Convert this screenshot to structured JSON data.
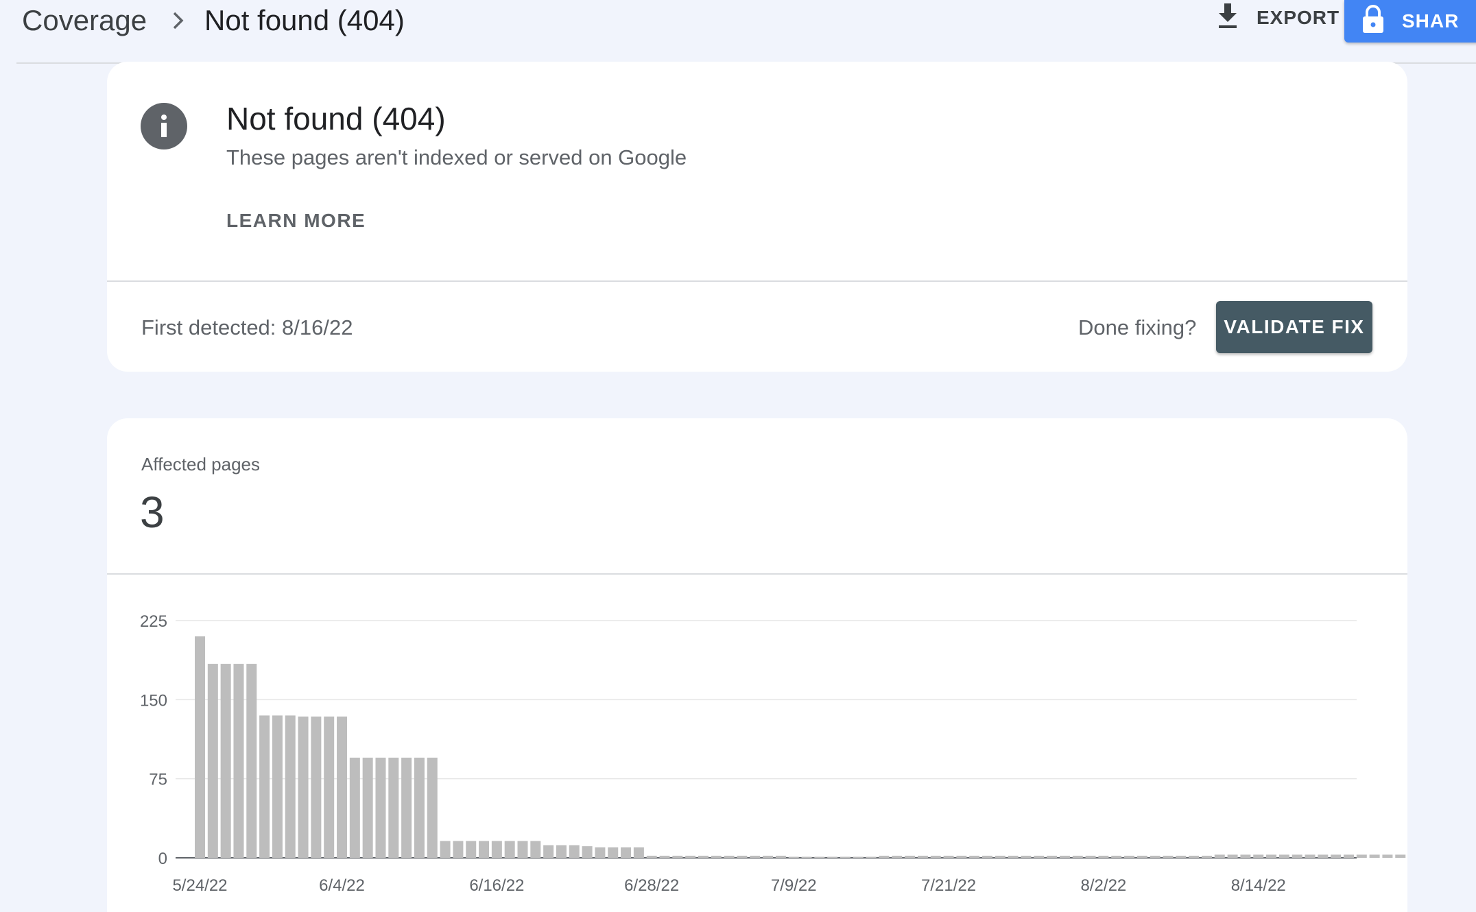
{
  "breadcrumb": {
    "root": "Coverage",
    "separator_icon": "chevron-right-icon",
    "current": "Not found (404)"
  },
  "toolbar": {
    "export_label": "EXPORT",
    "export_icon": "download-icon",
    "share_label": "SHAR",
    "share_icon": "lock-icon",
    "share_color": "#4285f4"
  },
  "issue": {
    "icon": "info-icon",
    "title": "Not found (404)",
    "subtitle": "These pages aren't indexed or served on Google",
    "learn_more": "LEARN MORE",
    "first_detected": "First detected: 8/16/22",
    "done_fixing": "Done fixing?",
    "validate_label": "VALIDATE FIX",
    "validate_color": "#455a64"
  },
  "affected": {
    "label": "Affected pages",
    "value": "3"
  },
  "chart_data": {
    "type": "bar",
    "ylim": [
      0,
      225
    ],
    "yticks": [
      0,
      75,
      150,
      225
    ],
    "xtick_labels": [
      "5/24/22",
      "6/4/22",
      "6/16/22",
      "6/28/22",
      "7/9/22",
      "7/21/22",
      "8/2/22",
      "8/14/22"
    ],
    "xtick_indices": [
      0,
      11,
      23,
      35,
      46,
      58,
      70,
      82
    ],
    "bar_color": "#bdbdbd",
    "grid": true,
    "values": [
      210,
      184,
      184,
      184,
      184,
      135,
      135,
      135,
      134,
      134,
      134,
      134,
      95,
      95,
      95,
      95,
      95,
      95,
      95,
      16,
      16,
      16,
      16,
      16,
      16,
      16,
      16,
      12,
      12,
      12,
      11,
      10,
      10,
      10,
      10,
      2,
      2,
      2,
      2,
      2,
      2,
      2,
      2,
      2,
      2,
      2,
      1,
      1,
      1,
      1,
      1,
      1,
      1,
      2,
      2,
      2,
      2,
      2,
      2,
      2,
      2,
      2,
      2,
      2,
      2,
      2,
      2,
      2,
      2,
      2,
      2,
      2,
      2,
      2,
      2,
      2,
      2,
      2,
      2,
      3,
      3,
      3,
      3,
      3,
      3,
      3,
      3,
      3,
      3,
      3,
      3,
      3,
      3,
      3,
      3,
      3,
      3
    ]
  }
}
